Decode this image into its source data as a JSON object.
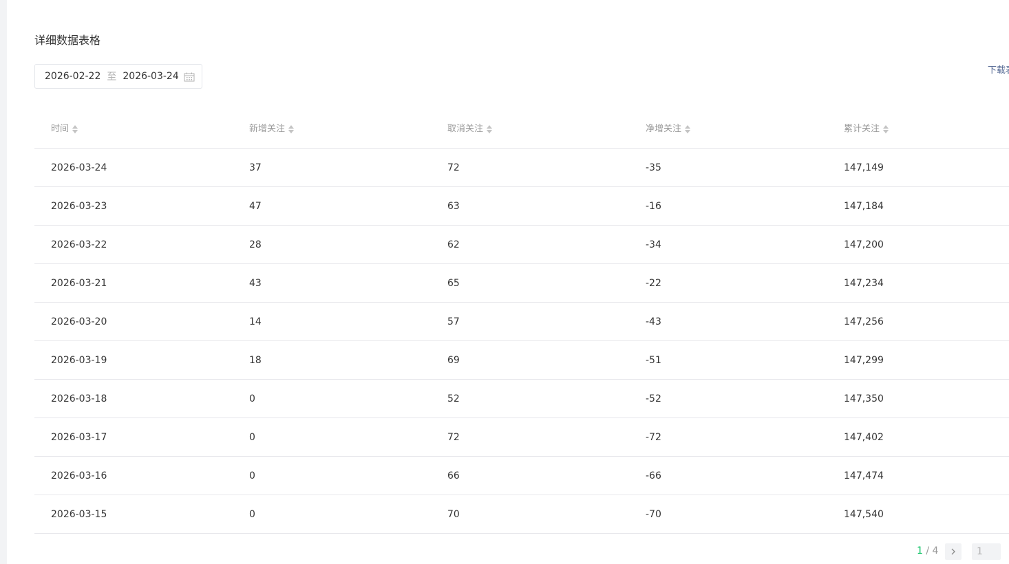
{
  "section": {
    "title": "详细数据表格"
  },
  "date_range": {
    "start": "2026-02-22",
    "separator": "至",
    "end": "2026-03-24"
  },
  "download": {
    "label": "下载表格"
  },
  "table": {
    "columns": [
      "时间",
      "新增关注",
      "取消关注",
      "净增关注",
      "累计关注"
    ],
    "rows": [
      [
        "2026-03-24",
        "37",
        "72",
        "-35",
        "147,149"
      ],
      [
        "2026-03-23",
        "47",
        "63",
        "-16",
        "147,184"
      ],
      [
        "2026-03-22",
        "28",
        "62",
        "-34",
        "147,200"
      ],
      [
        "2026-03-21",
        "43",
        "65",
        "-22",
        "147,234"
      ],
      [
        "2026-03-20",
        "14",
        "57",
        "-43",
        "147,256"
      ],
      [
        "2026-03-19",
        "18",
        "69",
        "-51",
        "147,299"
      ],
      [
        "2026-03-18",
        "0",
        "52",
        "-52",
        "147,350"
      ],
      [
        "2026-03-17",
        "0",
        "72",
        "-72",
        "147,402"
      ],
      [
        "2026-03-16",
        "0",
        "66",
        "-66",
        "147,474"
      ],
      [
        "2026-03-15",
        "0",
        "70",
        "-70",
        "147,540"
      ]
    ]
  },
  "pagination": {
    "current": "1",
    "separator": " / ",
    "total": "4",
    "jump_value": "1"
  },
  "icons": {
    "calendar": "calendar-icon",
    "sort": "sort-icon",
    "next": "chevron-right-icon"
  },
  "colors": {
    "accent": "#07c160",
    "link": "#576b95",
    "border": "#e7e7eb",
    "muted": "#9a9a9a"
  }
}
